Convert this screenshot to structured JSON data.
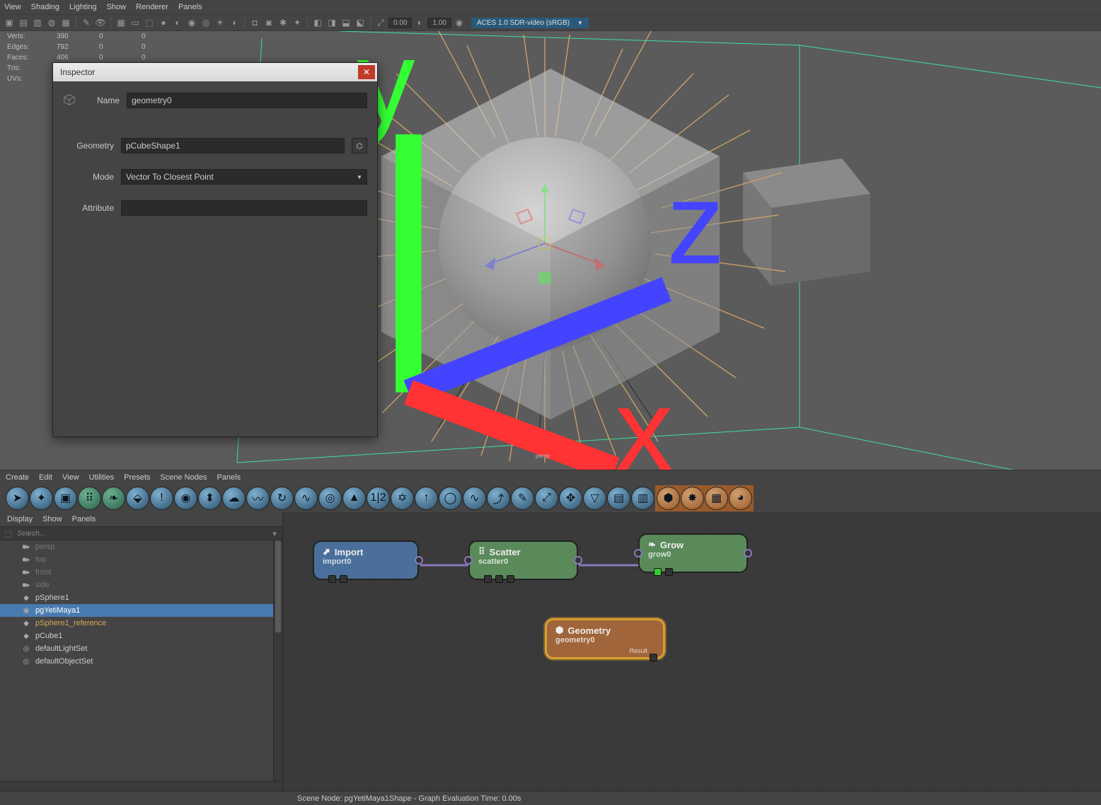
{
  "top_menu": [
    "View",
    "Shading",
    "Lighting",
    "Show",
    "Renderer",
    "Panels"
  ],
  "toolbar": {
    "frame1": "0.00",
    "frame2": "1.00",
    "aces_label": "ACES 1.0 SDR-video (sRGB)"
  },
  "hud": {
    "rows": [
      {
        "label": "Verts:",
        "a": "390",
        "b": "0",
        "c": "0"
      },
      {
        "label": "Edges:",
        "a": "792",
        "b": "0",
        "c": "0"
      },
      {
        "label": "Faces:",
        "a": "406",
        "b": "0",
        "c": "0"
      },
      {
        "label": "Tris:",
        "a": "",
        "b": "",
        "c": ""
      },
      {
        "label": "UVs:",
        "a": "",
        "b": "",
        "c": ""
      }
    ]
  },
  "inspector": {
    "title": "Inspector",
    "name_label": "Name",
    "name_value": "geometry0",
    "geometry_label": "Geometry",
    "geometry_value": "pCubeShape1",
    "mode_label": "Mode",
    "mode_value": "Vector To Closest Point",
    "attribute_label": "Attribute",
    "attribute_value": ""
  },
  "persp_label": "persp",
  "ne_menu": [
    "Create",
    "Edit",
    "View",
    "Utilities",
    "Presets",
    "Scene Nodes",
    "Panels"
  ],
  "outliner_menu": [
    "Display",
    "Show",
    "Panels"
  ],
  "outliner_search_placeholder": "Search...",
  "outliner_items": [
    {
      "label": "persp",
      "dim": true,
      "icon": "cam"
    },
    {
      "label": "top",
      "dim": true,
      "icon": "cam"
    },
    {
      "label": "front",
      "dim": true,
      "icon": "cam"
    },
    {
      "label": "side",
      "dim": true,
      "icon": "cam"
    },
    {
      "label": "pSphere1",
      "icon": "mesh"
    },
    {
      "label": "pgYetiMaya1",
      "icon": "yeti",
      "sel": true
    },
    {
      "label": "pSphere1_reference",
      "icon": "mesh",
      "hi": true
    },
    {
      "label": "pCube1",
      "icon": "mesh"
    },
    {
      "label": "defaultLightSet",
      "icon": "set"
    },
    {
      "label": "defaultObjectSet",
      "icon": "set"
    }
  ],
  "nodes": {
    "import": {
      "title": "Import",
      "sub": "import0"
    },
    "scatter": {
      "title": "Scatter",
      "sub": "scatter0"
    },
    "grow": {
      "title": "Grow",
      "sub": "grow0"
    },
    "geometry": {
      "title": "Geometry",
      "sub": "geometry0",
      "result": "Result"
    }
  },
  "statusbar": "Scene Node: pgYetiMaya1Shape - Graph Evaluation Time: 0.00s"
}
